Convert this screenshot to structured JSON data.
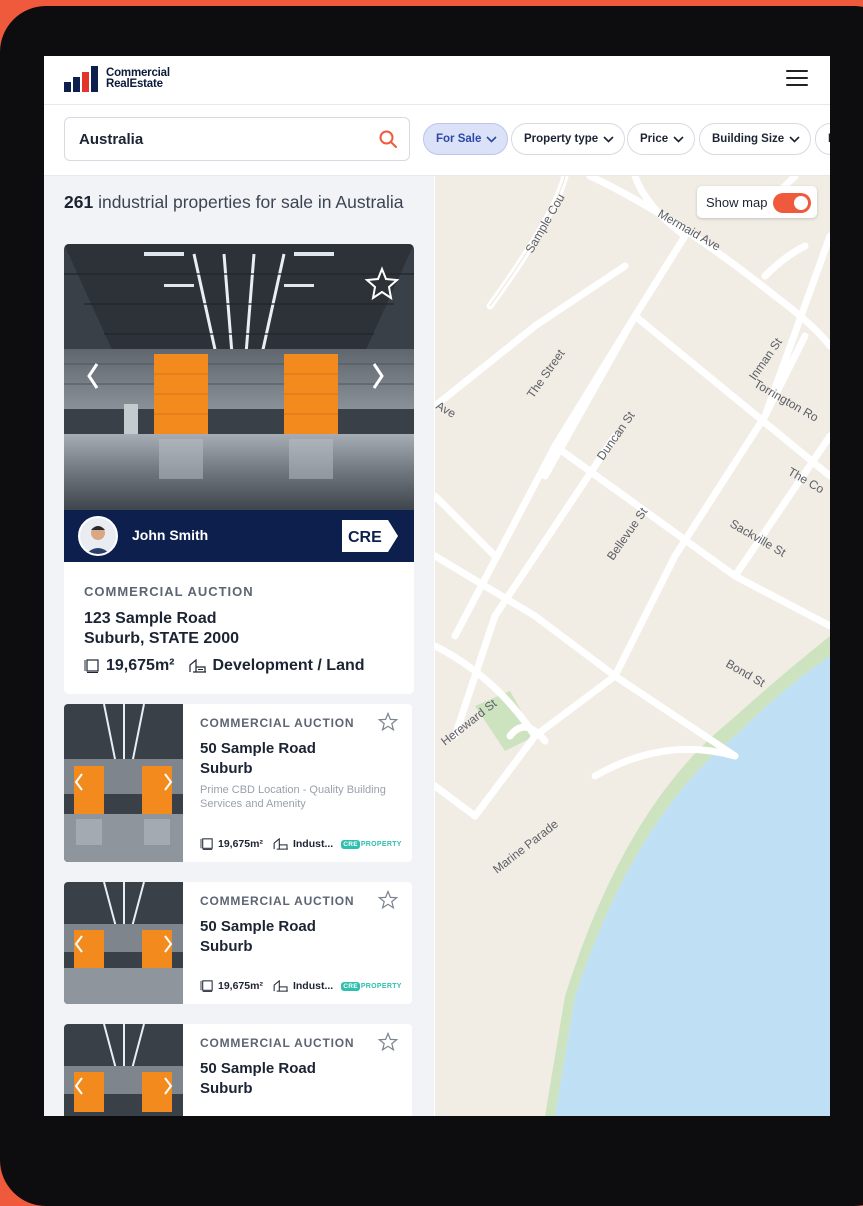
{
  "header": {
    "logo_line1": "Commercial",
    "logo_line2": "RealEstate"
  },
  "search": {
    "value": "Australia"
  },
  "filters": [
    {
      "label": "For Sale",
      "active": true
    },
    {
      "label": "Property type",
      "active": false
    },
    {
      "label": "Price",
      "active": false
    },
    {
      "label": "Building Size",
      "active": false
    },
    {
      "label": "L",
      "active": false
    }
  ],
  "results": {
    "count": "261",
    "text": "industrial properties for sale in Australia"
  },
  "featured": {
    "agent_name": "John Smith",
    "badge": "CRE",
    "type": "COMMERCIAL AUCTION",
    "address_line1": "123 Sample Road",
    "address_line2": "Suburb, STATE 2000",
    "size": "19,675m²",
    "category": "Development / Land"
  },
  "listings": [
    {
      "type": "COMMERCIAL AUCTION",
      "address_line1": "50 Sample Road",
      "address_line2": "Suburb",
      "description": "Prime CBD Location - Quality Building Services and Amenity",
      "size": "19,675m²",
      "category": "Indust...",
      "logo_box": "CRE",
      "logo_text": "PROPERTY"
    },
    {
      "type": "COMMERCIAL AUCTION",
      "address_line1": "50 Sample Road",
      "address_line2": "Suburb",
      "size": "19,675m²",
      "category": "Indust...",
      "logo_box": "CRE",
      "logo_text": "PROPERTY"
    },
    {
      "type": "COMMERCIAL AUCTION",
      "address_line1": "50 Sample Road",
      "address_line2": "Suburb"
    }
  ],
  "map": {
    "toggle_label": "Show map",
    "toggle_on": true,
    "streets": [
      "Sample Cou",
      "Mermaid Ave",
      "Inman St",
      "The Street",
      "Torrington Ro",
      "Ave",
      "Duncan St",
      "The Co",
      "Bellevue St",
      "Sackville St",
      "Hereward St",
      "Bond St",
      "Marine Parade"
    ]
  },
  "colors": {
    "brand": "#f05a3c",
    "navy": "#0c1f4d",
    "door_orange": "#f28a1e",
    "water": "#bfdff4",
    "park": "#cde3bf",
    "map_land": "#f1ece4"
  }
}
